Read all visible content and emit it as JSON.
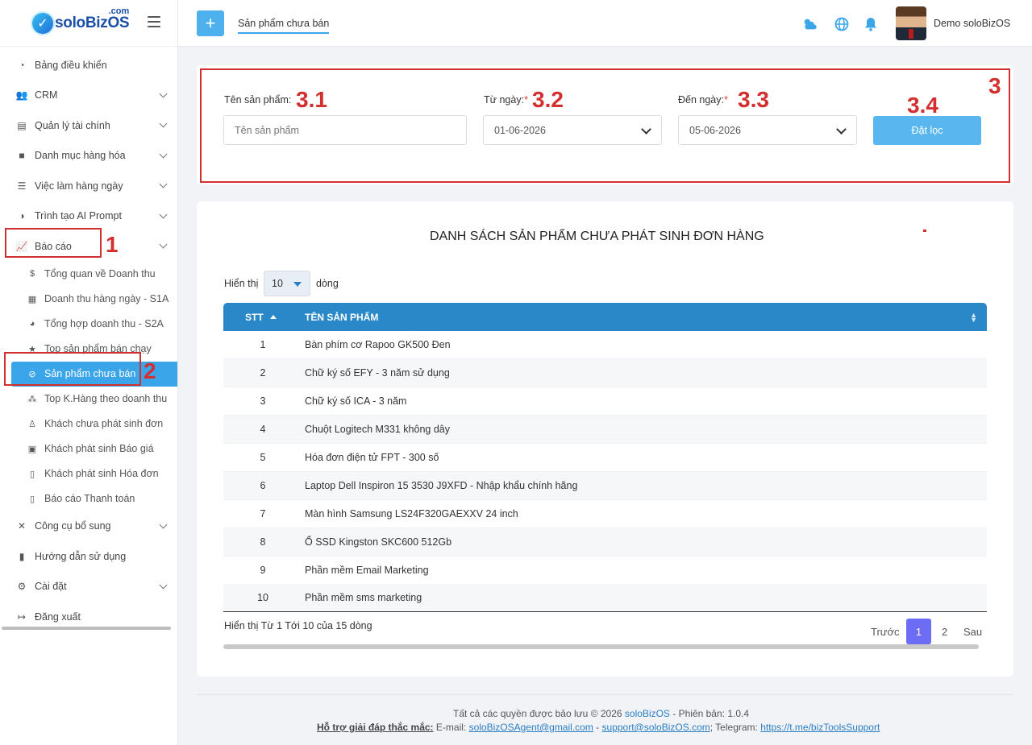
{
  "app": {
    "logo_text": "soloBizOS",
    "logo_suffix": ".com"
  },
  "sidebar": {
    "items": [
      {
        "label": "Bảng điều khiển",
        "icon": "dashboard-icon"
      },
      {
        "label": "CRM",
        "icon": "users-icon"
      },
      {
        "label": "Quản lý tài chính",
        "icon": "finance-icon"
      },
      {
        "label": "Danh mục hàng hóa",
        "icon": "box-icon"
      },
      {
        "label": "Việc làm hàng ngày",
        "icon": "checklist-icon"
      },
      {
        "label": "Trình tạo AI Prompt",
        "icon": "brain-icon"
      },
      {
        "label": "Báo cáo",
        "icon": "report-icon"
      },
      {
        "label": "Công cụ bổ sung",
        "icon": "tools-icon"
      },
      {
        "label": "Hướng dẫn sử dụng",
        "icon": "book-icon"
      },
      {
        "label": "Cài đặt",
        "icon": "gear-icon"
      },
      {
        "label": "Đăng xuất",
        "icon": "logout-icon"
      }
    ],
    "report_sub": [
      {
        "label": "Tổng quan về Doanh thu",
        "icon": "money-bag-icon"
      },
      {
        "label": "Doanh thu hàng ngày - S1A",
        "icon": "calendar-icon"
      },
      {
        "label": "Tổng hợp doanh thu - S2A",
        "icon": "pie-icon"
      },
      {
        "label": "Top sản phẩm bán chạy",
        "icon": "star-icon"
      },
      {
        "label": "Sản phẩm chưa bán",
        "icon": "ban-icon"
      },
      {
        "label": "Top K.Hàng theo doanh thu",
        "icon": "group-icon"
      },
      {
        "label": "Khách chưa phát sinh đơn",
        "icon": "user-clock-icon"
      },
      {
        "label": "Khách phát sinh Báo giá",
        "icon": "file-user-icon"
      },
      {
        "label": "Khách phát sinh Hóa đơn",
        "icon": "invoice-icon"
      },
      {
        "label": "Báo cáo Thanh toán",
        "icon": "file-icon"
      }
    ]
  },
  "header": {
    "tab": "Sản phẩm chưa bán",
    "username": "Demo soloBizOS"
  },
  "filter": {
    "name_label": "Tên sản phẩm:",
    "name_placeholder": "Tên sản phẩm",
    "from_label": "Từ ngày:",
    "from_value": "01-06-2026",
    "to_label": "Đến ngày:",
    "to_value": "05-06-2026",
    "required_mark": "*",
    "submit_label": "Đặt lọc"
  },
  "annotations": {
    "a1": "1",
    "a2": "2",
    "a3": "3",
    "a31": "3.1",
    "a32": "3.2",
    "a33": "3.3",
    "a34": "3.4"
  },
  "list": {
    "title": "DANH SÁCH SẢN PHẨM CHƯA PHÁT SINH ĐƠN HÀNG",
    "show_prefix": "Hiển thị",
    "page_size": "10",
    "show_suffix": "dòng",
    "columns": {
      "stt": "STT",
      "name": "TÊN SẢN PHẨM"
    },
    "rows": [
      {
        "stt": "1",
        "name": "Bàn phím cơ Rapoo GK500 Đen"
      },
      {
        "stt": "2",
        "name": "Chữ ký số EFY - 3 năm sử dụng"
      },
      {
        "stt": "3",
        "name": "Chữ ký số ICA - 3 năm"
      },
      {
        "stt": "4",
        "name": "Chuột Logitech M331 không dây"
      },
      {
        "stt": "5",
        "name": "Hóa đơn điện tử FPT - 300 số"
      },
      {
        "stt": "6",
        "name": "Laptop Dell Inspiron 15 3530 J9XFD - Nhập khẩu chính hãng"
      },
      {
        "stt": "7",
        "name": "Màn hình Samsung LS24F320GAEXXV 24 inch"
      },
      {
        "stt": "8",
        "name": "Ổ SSD Kingston SKC600 512Gb"
      },
      {
        "stt": "9",
        "name": "Phần mềm Email Marketing"
      },
      {
        "stt": "10",
        "name": "Phần mềm sms marketing"
      }
    ],
    "info": "Hiển thị Từ 1 Tới 10 của 15 dòng",
    "pagination": {
      "prev": "Trước",
      "p1": "1",
      "p2": "2",
      "next": "Sau"
    }
  },
  "footer": {
    "copyright_prefix": "Tất cả các quyền được bảo lưu © 2026",
    "brand": "soloBizOS",
    "version": "- Phiên bản: 1.0.4",
    "support_label": "Hỗ trợ giải đáp thắc mắc:",
    "email_label": " E-mail:",
    "email1": "soloBizOSAgent@gmail.com",
    "sep": " - ",
    "email2": "support@soloBizOS.com",
    "telegram_label": "; Telegram:",
    "telegram": "https://t.me/bizToolsSupport"
  },
  "colors": {
    "primary": "#2a88c8",
    "accent": "#3ba5ea",
    "annotation": "#d32f2f",
    "pager_active": "#6c6cf5"
  }
}
